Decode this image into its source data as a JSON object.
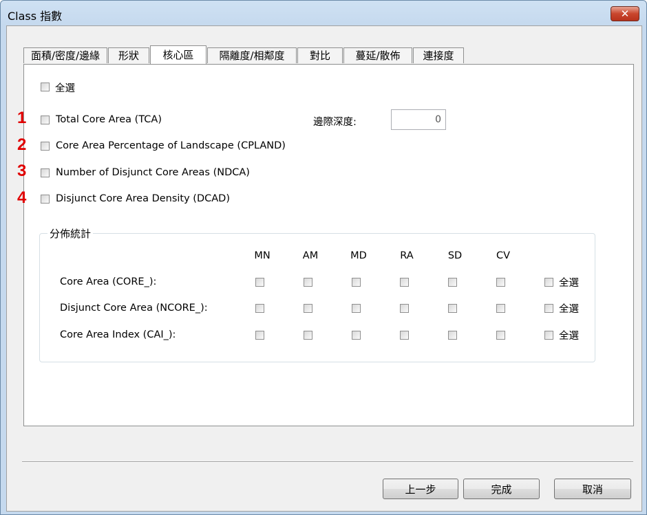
{
  "window": {
    "title": "Class 指數",
    "close_symbol": "✕"
  },
  "tabs": [
    {
      "label": "面積/密度/邊緣"
    },
    {
      "label": "形狀"
    },
    {
      "label": "核心區"
    },
    {
      "label": "隔離度/相鄰度"
    },
    {
      "label": "對比"
    },
    {
      "label": "蔓延/散佈"
    },
    {
      "label": "連接度"
    }
  ],
  "panel": {
    "select_all_label": "全選",
    "metrics": [
      {
        "number": "1",
        "label": "Total Core Area (TCA)"
      },
      {
        "number": "2",
        "label": "Core Area Percentage of Landscape (CPLAND)"
      },
      {
        "number": "3",
        "label": "Number of Disjunct Core Areas (NDCA)"
      },
      {
        "number": "4",
        "label": "Disjunct Core Area Density (DCAD)"
      }
    ],
    "edge_depth": {
      "label": "邊際深度:",
      "value": "0"
    },
    "distribution": {
      "title": "分佈統計",
      "columns": [
        "MN",
        "AM",
        "MD",
        "RA",
        "SD",
        "CV"
      ],
      "rows": [
        {
          "label": "Core Area (CORE_):",
          "select_all": "全選"
        },
        {
          "label": "Disjunct Core Area (NCORE_):",
          "select_all": "全選"
        },
        {
          "label": "Core Area Index (CAI_):",
          "select_all": "全選"
        }
      ]
    }
  },
  "buttons": {
    "back": "上一步",
    "finish": "完成",
    "cancel": "取消"
  }
}
